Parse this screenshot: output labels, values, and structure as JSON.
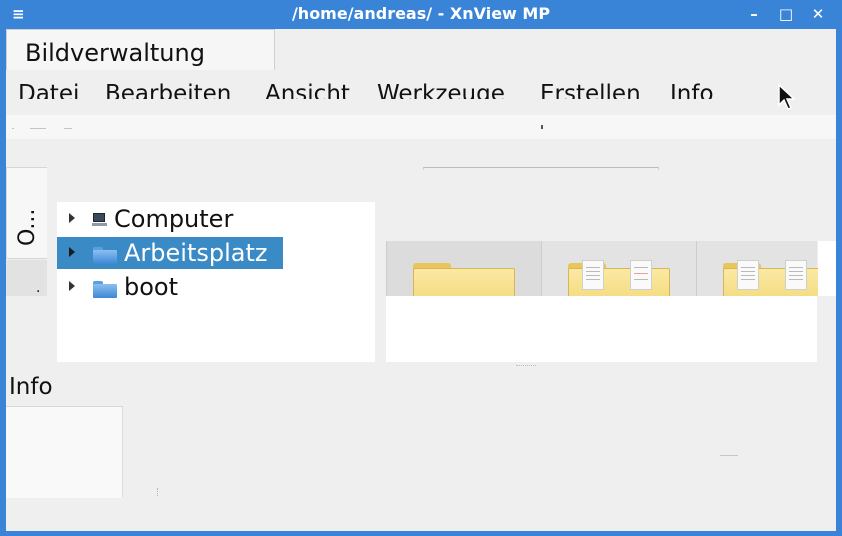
{
  "window": {
    "title": "/home/andreas/ - XnView MP",
    "menu_glyph": "≡",
    "minimize_glyph": "–",
    "maximize_glyph": "□",
    "close_glyph": "✕",
    "titlebar_color": "#3a84d8"
  },
  "main_tab": {
    "label": "Bildverwaltung"
  },
  "menubar": {
    "items": [
      "Datei",
      "Bearbeiten",
      "Ansicht",
      "Werkzeuge",
      "Erstellen",
      "Info"
    ]
  },
  "side_tabs": {
    "first": "O...",
    "second": "."
  },
  "tree": {
    "items": [
      {
        "label": "Computer",
        "icon": "computer-icon",
        "selected": false
      },
      {
        "label": "Arbeitsplatz",
        "icon": "folder-icon",
        "selected": true
      },
      {
        "label": "boot",
        "icon": "folder-icon",
        "selected": false
      }
    ],
    "selection_color": "#3a8ac6"
  },
  "info_panel": {
    "title": "Info"
  }
}
